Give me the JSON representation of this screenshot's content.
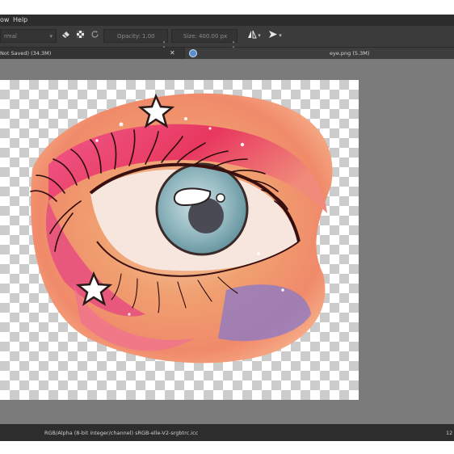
{
  "menu": {
    "items": [
      "ow",
      "Help"
    ]
  },
  "toolbar": {
    "blend_mode": "rmal",
    "opacity_label": "Opacity:",
    "opacity_value": "1.00",
    "size_label": "Size:",
    "size_value": "400.00 px"
  },
  "tabs": {
    "first": "Not Saved)  (34.3M)",
    "second": "eye.png (5.3M)"
  },
  "status": {
    "color_space": "RGB/Alpha (8-bit integer/channel)  sRGB-elle-V2-srgbtrc.icc",
    "right_value": "12"
  },
  "icons": {
    "eraser": "eraser-icon",
    "alpha": "alpha-lock-icon",
    "reload": "reload-icon",
    "mirror": "mirror-icon",
    "wrap": "wrap-arrow-icon",
    "tools": "tools-icon",
    "globe": "globe-icon"
  }
}
